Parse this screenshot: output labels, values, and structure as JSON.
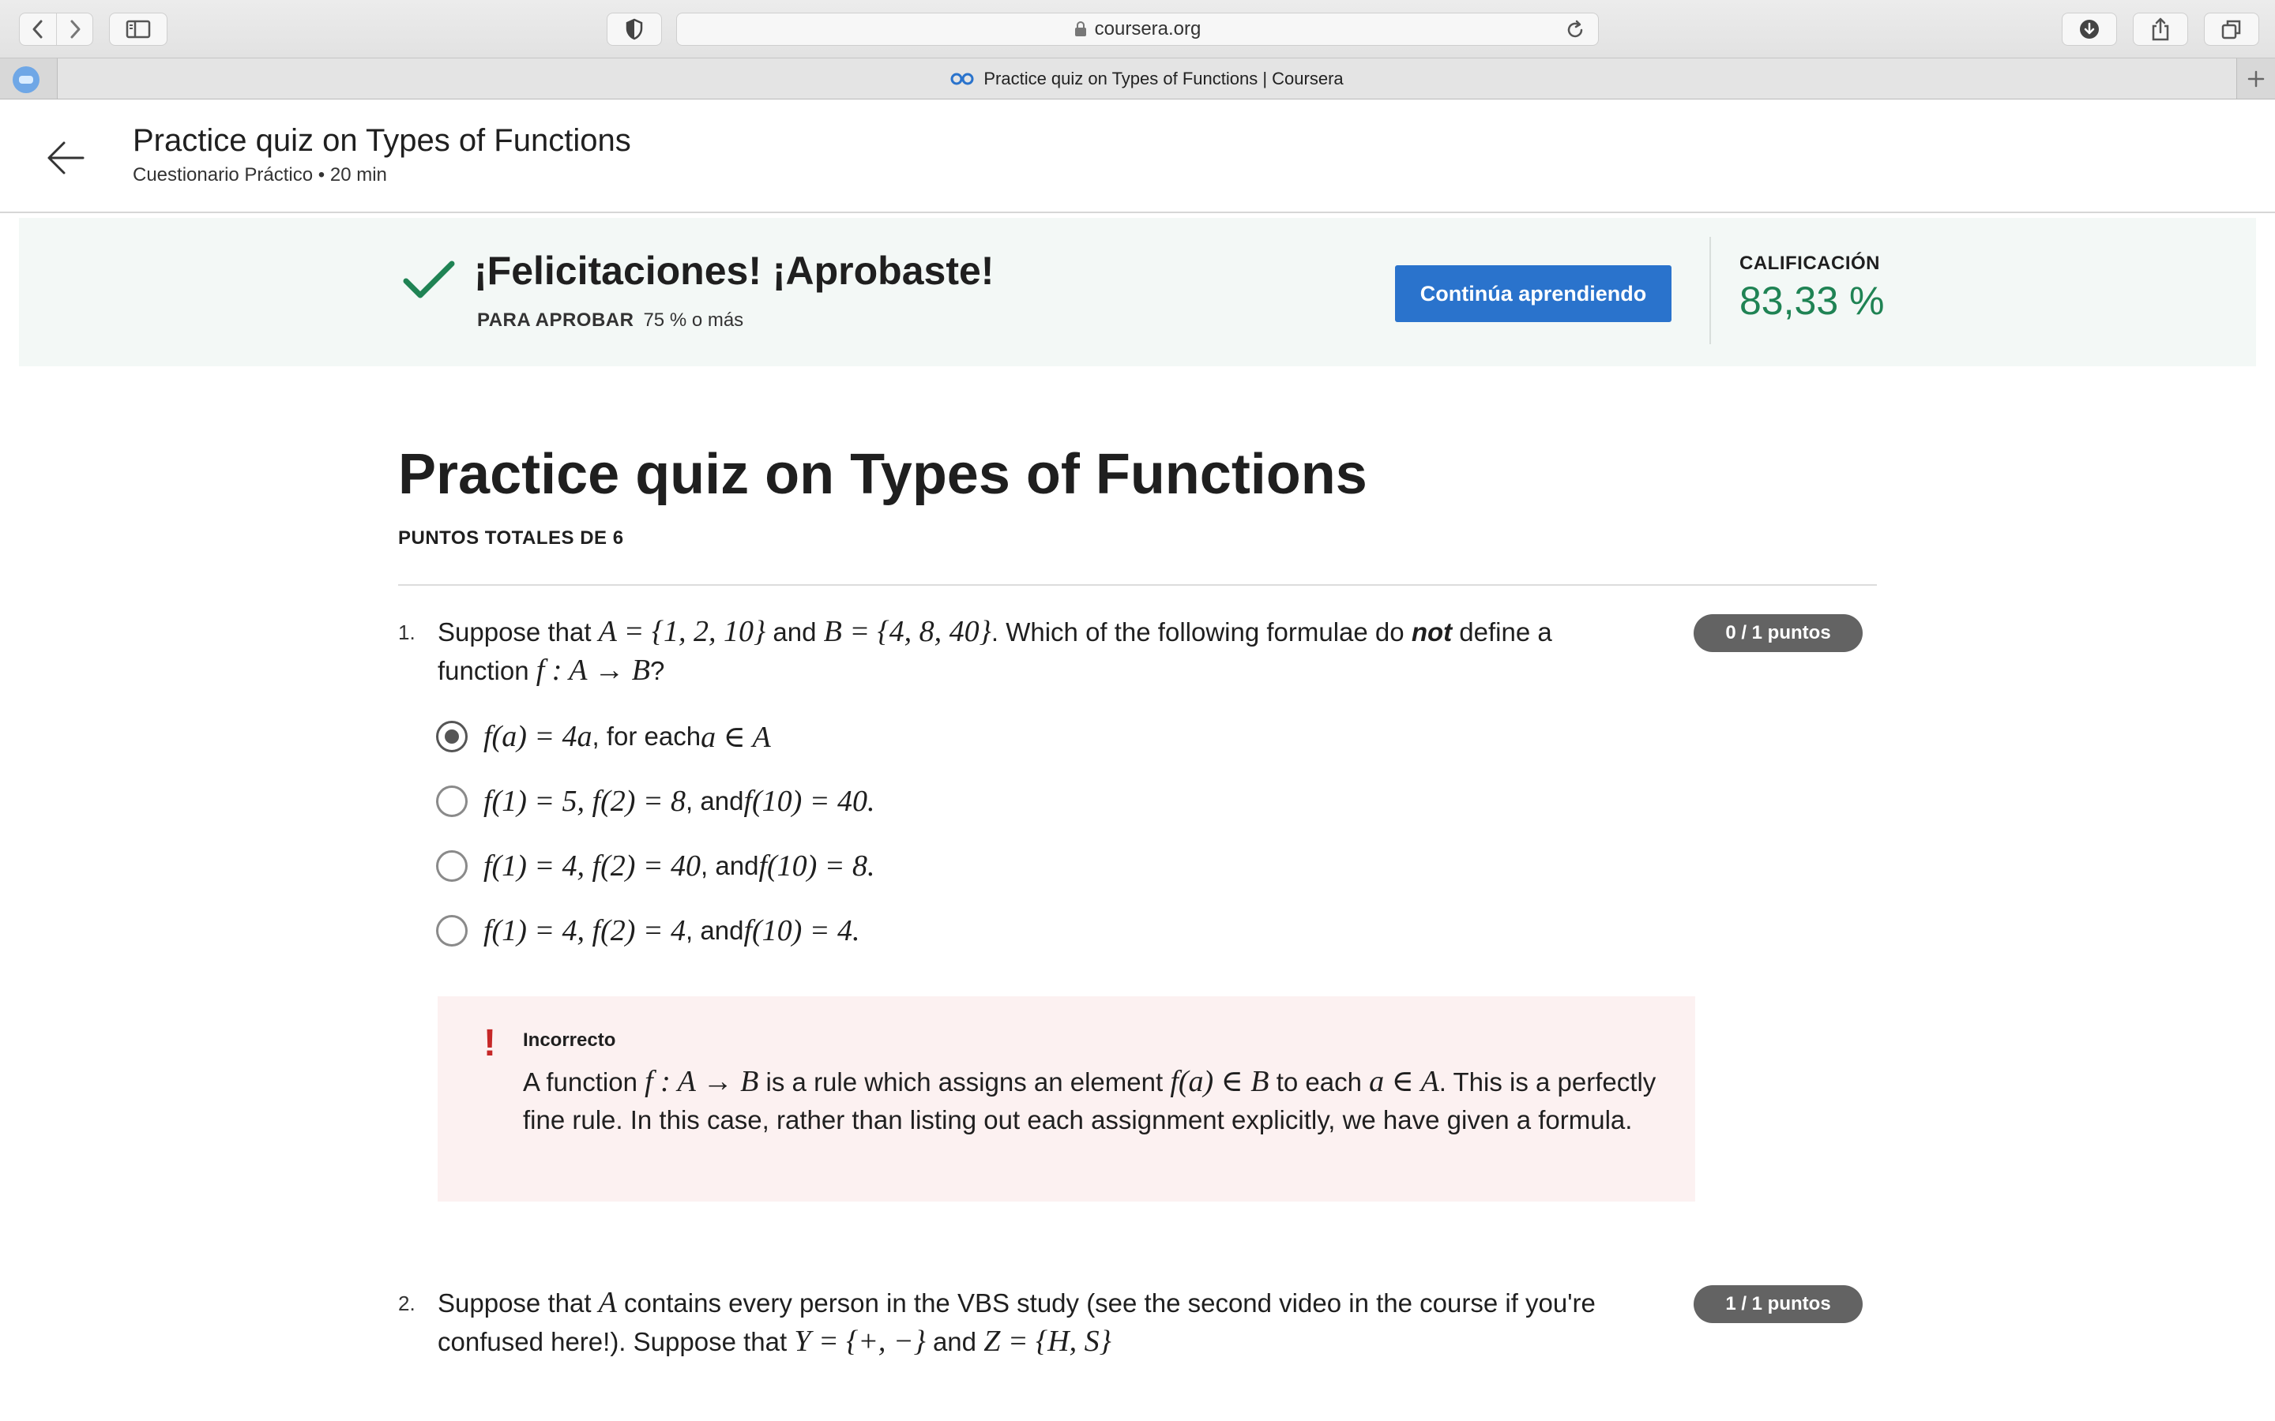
{
  "browser": {
    "url": "coursera.org",
    "tab_title": "Practice quiz on Types of Functions | Coursera"
  },
  "header": {
    "title": "Practice quiz on Types of Functions",
    "subtitle": "Cuestionario Práctico • 20 min"
  },
  "banner": {
    "title": "¡Felicitaciones! ¡Aprobaste!",
    "pass_label": "PARA APROBAR",
    "pass_value": "75 % o más",
    "continue_label": "Continúa aprendiendo",
    "grade_label": "CALIFICACIÓN",
    "grade_value": "83,33 %",
    "success_color": "#1f8354",
    "button_color": "#2a73cc"
  },
  "quiz": {
    "title": "Practice quiz on Types of Functions",
    "total_points": "PUNTOS TOTALES DE 6",
    "questions": [
      {
        "number": "1.",
        "score": "0 / 1 puntos",
        "text": {
          "p1": "Suppose that ",
          "m1": "A = {1, 2, 10}",
          "p2": " and ",
          "m2": "B = {4, 8, 40}",
          "p3": ". Which of the following formulae do ",
          "emph": "not",
          "p4": " define a function ",
          "m3": "f : A → B",
          "p5": "?"
        },
        "options": [
          {
            "m1": "f(a) = 4a",
            "t1": ", for each ",
            "m2": "a ∈ A",
            "selected": true
          },
          {
            "m1": "f(1) = 5, f(2) = 8",
            "t1": ", and ",
            "m2": "f(10) = 40.",
            "selected": false
          },
          {
            "m1": "f(1) = 4, f(2) = 40",
            "t1": ", and ",
            "m2": "f(10) = 8.",
            "selected": false
          },
          {
            "m1": "f(1) = 4, f(2) = 4",
            "t1": ", and ",
            "m2": "f(10) = 4.",
            "selected": false
          }
        ],
        "feedback": {
          "title": "Incorrecto",
          "p1": "A function ",
          "m1": "f : A → B",
          "p2": " is a rule which assigns an element ",
          "m2": "f(a) ∈ B",
          "p3": " to each ",
          "m3": "a ∈ A",
          "p4": ". This is a perfectly fine rule. In this case, rather than listing out each assignment explicitly, we have given a formula."
        }
      },
      {
        "number": "2.",
        "score": "1 / 1 puntos",
        "text": {
          "p1": "Suppose that ",
          "m1": "A",
          "p2": " contains every person in the VBS study (see the second video in the course if you're confused here!). Suppose that ",
          "m2": "Y = {+, −}",
          "p3": " and ",
          "m3": "Z = {H, S}"
        }
      }
    ]
  },
  "icons": [
    "chevron-left-icon",
    "chevron-right-icon",
    "sidebar-icon",
    "shield-icon",
    "lock-icon",
    "reload-icon",
    "download-icon",
    "share-icon",
    "tabs-icon",
    "coursera-logo-icon",
    "plus-icon",
    "back-arrow-icon",
    "check-icon",
    "exclamation-icon"
  ]
}
